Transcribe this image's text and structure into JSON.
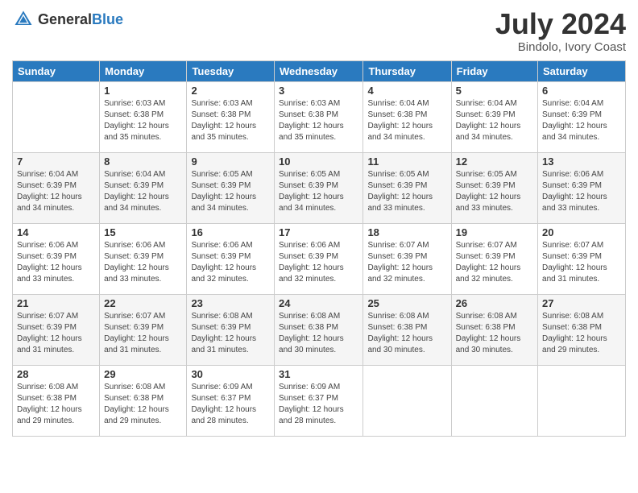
{
  "header": {
    "logo_general": "General",
    "logo_blue": "Blue",
    "title": "July 2024",
    "location": "Bindolo, Ivory Coast"
  },
  "columns": [
    "Sunday",
    "Monday",
    "Tuesday",
    "Wednesday",
    "Thursday",
    "Friday",
    "Saturday"
  ],
  "weeks": [
    [
      {
        "day": "",
        "sunrise": "",
        "sunset": "",
        "daylight": ""
      },
      {
        "day": "1",
        "sunrise": "Sunrise: 6:03 AM",
        "sunset": "Sunset: 6:38 PM",
        "daylight": "Daylight: 12 hours and 35 minutes."
      },
      {
        "day": "2",
        "sunrise": "Sunrise: 6:03 AM",
        "sunset": "Sunset: 6:38 PM",
        "daylight": "Daylight: 12 hours and 35 minutes."
      },
      {
        "day": "3",
        "sunrise": "Sunrise: 6:03 AM",
        "sunset": "Sunset: 6:38 PM",
        "daylight": "Daylight: 12 hours and 35 minutes."
      },
      {
        "day": "4",
        "sunrise": "Sunrise: 6:04 AM",
        "sunset": "Sunset: 6:38 PM",
        "daylight": "Daylight: 12 hours and 34 minutes."
      },
      {
        "day": "5",
        "sunrise": "Sunrise: 6:04 AM",
        "sunset": "Sunset: 6:39 PM",
        "daylight": "Daylight: 12 hours and 34 minutes."
      },
      {
        "day": "6",
        "sunrise": "Sunrise: 6:04 AM",
        "sunset": "Sunset: 6:39 PM",
        "daylight": "Daylight: 12 hours and 34 minutes."
      }
    ],
    [
      {
        "day": "7",
        "sunrise": "Sunrise: 6:04 AM",
        "sunset": "Sunset: 6:39 PM",
        "daylight": "Daylight: 12 hours and 34 minutes."
      },
      {
        "day": "8",
        "sunrise": "Sunrise: 6:04 AM",
        "sunset": "Sunset: 6:39 PM",
        "daylight": "Daylight: 12 hours and 34 minutes."
      },
      {
        "day": "9",
        "sunrise": "Sunrise: 6:05 AM",
        "sunset": "Sunset: 6:39 PM",
        "daylight": "Daylight: 12 hours and 34 minutes."
      },
      {
        "day": "10",
        "sunrise": "Sunrise: 6:05 AM",
        "sunset": "Sunset: 6:39 PM",
        "daylight": "Daylight: 12 hours and 34 minutes."
      },
      {
        "day": "11",
        "sunrise": "Sunrise: 6:05 AM",
        "sunset": "Sunset: 6:39 PM",
        "daylight": "Daylight: 12 hours and 33 minutes."
      },
      {
        "day": "12",
        "sunrise": "Sunrise: 6:05 AM",
        "sunset": "Sunset: 6:39 PM",
        "daylight": "Daylight: 12 hours and 33 minutes."
      },
      {
        "day": "13",
        "sunrise": "Sunrise: 6:06 AM",
        "sunset": "Sunset: 6:39 PM",
        "daylight": "Daylight: 12 hours and 33 minutes."
      }
    ],
    [
      {
        "day": "14",
        "sunrise": "Sunrise: 6:06 AM",
        "sunset": "Sunset: 6:39 PM",
        "daylight": "Daylight: 12 hours and 33 minutes."
      },
      {
        "day": "15",
        "sunrise": "Sunrise: 6:06 AM",
        "sunset": "Sunset: 6:39 PM",
        "daylight": "Daylight: 12 hours and 33 minutes."
      },
      {
        "day": "16",
        "sunrise": "Sunrise: 6:06 AM",
        "sunset": "Sunset: 6:39 PM",
        "daylight": "Daylight: 12 hours and 32 minutes."
      },
      {
        "day": "17",
        "sunrise": "Sunrise: 6:06 AM",
        "sunset": "Sunset: 6:39 PM",
        "daylight": "Daylight: 12 hours and 32 minutes."
      },
      {
        "day": "18",
        "sunrise": "Sunrise: 6:07 AM",
        "sunset": "Sunset: 6:39 PM",
        "daylight": "Daylight: 12 hours and 32 minutes."
      },
      {
        "day": "19",
        "sunrise": "Sunrise: 6:07 AM",
        "sunset": "Sunset: 6:39 PM",
        "daylight": "Daylight: 12 hours and 32 minutes."
      },
      {
        "day": "20",
        "sunrise": "Sunrise: 6:07 AM",
        "sunset": "Sunset: 6:39 PM",
        "daylight": "Daylight: 12 hours and 31 minutes."
      }
    ],
    [
      {
        "day": "21",
        "sunrise": "Sunrise: 6:07 AM",
        "sunset": "Sunset: 6:39 PM",
        "daylight": "Daylight: 12 hours and 31 minutes."
      },
      {
        "day": "22",
        "sunrise": "Sunrise: 6:07 AM",
        "sunset": "Sunset: 6:39 PM",
        "daylight": "Daylight: 12 hours and 31 minutes."
      },
      {
        "day": "23",
        "sunrise": "Sunrise: 6:08 AM",
        "sunset": "Sunset: 6:39 PM",
        "daylight": "Daylight: 12 hours and 31 minutes."
      },
      {
        "day": "24",
        "sunrise": "Sunrise: 6:08 AM",
        "sunset": "Sunset: 6:38 PM",
        "daylight": "Daylight: 12 hours and 30 minutes."
      },
      {
        "day": "25",
        "sunrise": "Sunrise: 6:08 AM",
        "sunset": "Sunset: 6:38 PM",
        "daylight": "Daylight: 12 hours and 30 minutes."
      },
      {
        "day": "26",
        "sunrise": "Sunrise: 6:08 AM",
        "sunset": "Sunset: 6:38 PM",
        "daylight": "Daylight: 12 hours and 30 minutes."
      },
      {
        "day": "27",
        "sunrise": "Sunrise: 6:08 AM",
        "sunset": "Sunset: 6:38 PM",
        "daylight": "Daylight: 12 hours and 29 minutes."
      }
    ],
    [
      {
        "day": "28",
        "sunrise": "Sunrise: 6:08 AM",
        "sunset": "Sunset: 6:38 PM",
        "daylight": "Daylight: 12 hours and 29 minutes."
      },
      {
        "day": "29",
        "sunrise": "Sunrise: 6:08 AM",
        "sunset": "Sunset: 6:38 PM",
        "daylight": "Daylight: 12 hours and 29 minutes."
      },
      {
        "day": "30",
        "sunrise": "Sunrise: 6:09 AM",
        "sunset": "Sunset: 6:37 PM",
        "daylight": "Daylight: 12 hours and 28 minutes."
      },
      {
        "day": "31",
        "sunrise": "Sunrise: 6:09 AM",
        "sunset": "Sunset: 6:37 PM",
        "daylight": "Daylight: 12 hours and 28 minutes."
      },
      {
        "day": "",
        "sunrise": "",
        "sunset": "",
        "daylight": ""
      },
      {
        "day": "",
        "sunrise": "",
        "sunset": "",
        "daylight": ""
      },
      {
        "day": "",
        "sunrise": "",
        "sunset": "",
        "daylight": ""
      }
    ]
  ]
}
